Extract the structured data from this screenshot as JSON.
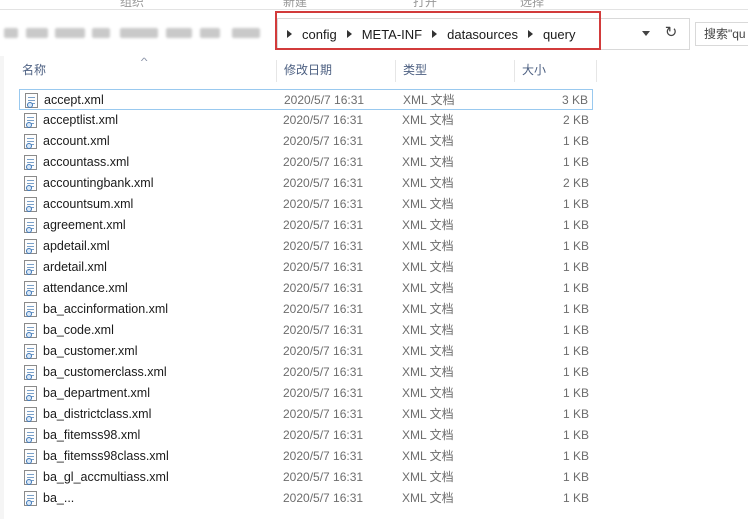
{
  "ribbon": {
    "items": [
      {
        "label": "组织"
      },
      {
        "label": "新建"
      },
      {
        "label": "打开"
      },
      {
        "label": "选择"
      }
    ]
  },
  "address": {
    "crumbs": [
      "config",
      "META-INF",
      "datasources",
      "query"
    ],
    "search_placeholder": "搜索\"qu"
  },
  "columns": {
    "name": "名称",
    "date": "修改日期",
    "type": "类型",
    "size": "大小"
  },
  "files": [
    {
      "name": "accept.xml",
      "date": "2020/5/7 16:31",
      "type": "XML 文档",
      "size": "3 KB",
      "selected": true
    },
    {
      "name": "acceptlist.xml",
      "date": "2020/5/7 16:31",
      "type": "XML 文档",
      "size": "2 KB"
    },
    {
      "name": "account.xml",
      "date": "2020/5/7 16:31",
      "type": "XML 文档",
      "size": "1 KB"
    },
    {
      "name": "accountass.xml",
      "date": "2020/5/7 16:31",
      "type": "XML 文档",
      "size": "1 KB"
    },
    {
      "name": "accountingbank.xml",
      "date": "2020/5/7 16:31",
      "type": "XML 文档",
      "size": "2 KB"
    },
    {
      "name": "accountsum.xml",
      "date": "2020/5/7 16:31",
      "type": "XML 文档",
      "size": "1 KB"
    },
    {
      "name": "agreement.xml",
      "date": "2020/5/7 16:31",
      "type": "XML 文档",
      "size": "1 KB"
    },
    {
      "name": "apdetail.xml",
      "date": "2020/5/7 16:31",
      "type": "XML 文档",
      "size": "1 KB"
    },
    {
      "name": "ardetail.xml",
      "date": "2020/5/7 16:31",
      "type": "XML 文档",
      "size": "1 KB"
    },
    {
      "name": "attendance.xml",
      "date": "2020/5/7 16:31",
      "type": "XML 文档",
      "size": "1 KB"
    },
    {
      "name": "ba_accinformation.xml",
      "date": "2020/5/7 16:31",
      "type": "XML 文档",
      "size": "1 KB"
    },
    {
      "name": "ba_code.xml",
      "date": "2020/5/7 16:31",
      "type": "XML 文档",
      "size": "1 KB"
    },
    {
      "name": "ba_customer.xml",
      "date": "2020/5/7 16:31",
      "type": "XML 文档",
      "size": "1 KB"
    },
    {
      "name": "ba_customerclass.xml",
      "date": "2020/5/7 16:31",
      "type": "XML 文档",
      "size": "1 KB"
    },
    {
      "name": "ba_department.xml",
      "date": "2020/5/7 16:31",
      "type": "XML 文档",
      "size": "1 KB"
    },
    {
      "name": "ba_districtclass.xml",
      "date": "2020/5/7 16:31",
      "type": "XML 文档",
      "size": "1 KB"
    },
    {
      "name": "ba_fitemss98.xml",
      "date": "2020/5/7 16:31",
      "type": "XML 文档",
      "size": "1 KB"
    },
    {
      "name": "ba_fitemss98class.xml",
      "date": "2020/5/7 16:31",
      "type": "XML 文档",
      "size": "1 KB"
    },
    {
      "name": "ba_gl_accmultiass.xml",
      "date": "2020/5/7 16:31",
      "type": "XML 文档",
      "size": "1 KB"
    },
    {
      "name": "ba_...",
      "date": "2020/5/7 16:31",
      "type": "XML 文档",
      "size": "1 KB"
    }
  ],
  "colors": {
    "highlight": "#d23b3b",
    "selection_border": "#99c9ef",
    "header_text": "#4d6082"
  }
}
